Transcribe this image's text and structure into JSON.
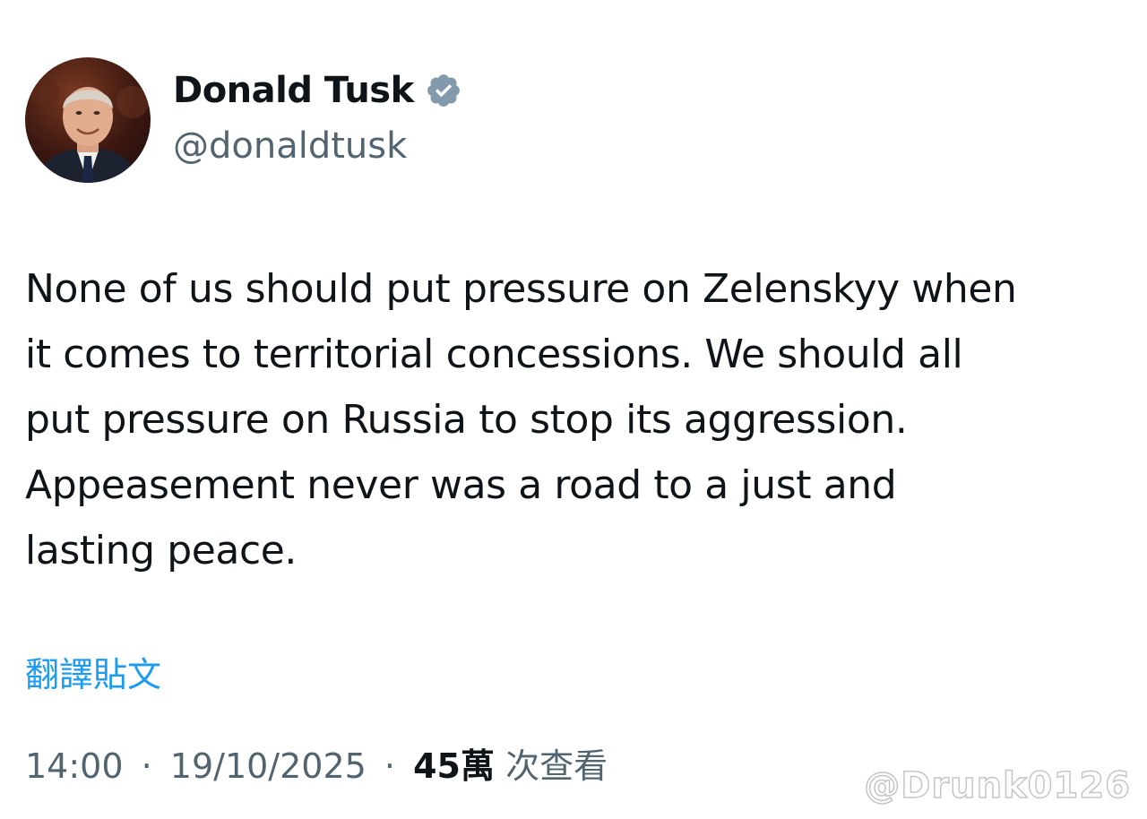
{
  "author": {
    "name": "Donald Tusk",
    "handle": "@donaldtusk",
    "verified": true,
    "verified_badge_color": "#829aab"
  },
  "tweet": {
    "lines": [
      "None of us should put pressure on Zelenskyy when",
      "it comes to territorial concessions. We should all",
      "put pressure on Russia to stop its aggression.",
      "Appeasement never was a road to a just and",
      "lasting peace."
    ]
  },
  "translate_label": "翻譯貼文",
  "meta": {
    "time": "14:00",
    "separator": "·",
    "date": "19/10/2025",
    "views_count": "45萬",
    "views_label": "次查看"
  },
  "watermark": "@Drunk0126",
  "colors": {
    "text": "#0f1419",
    "secondary": "#536471",
    "link": "#1d9bf0"
  }
}
